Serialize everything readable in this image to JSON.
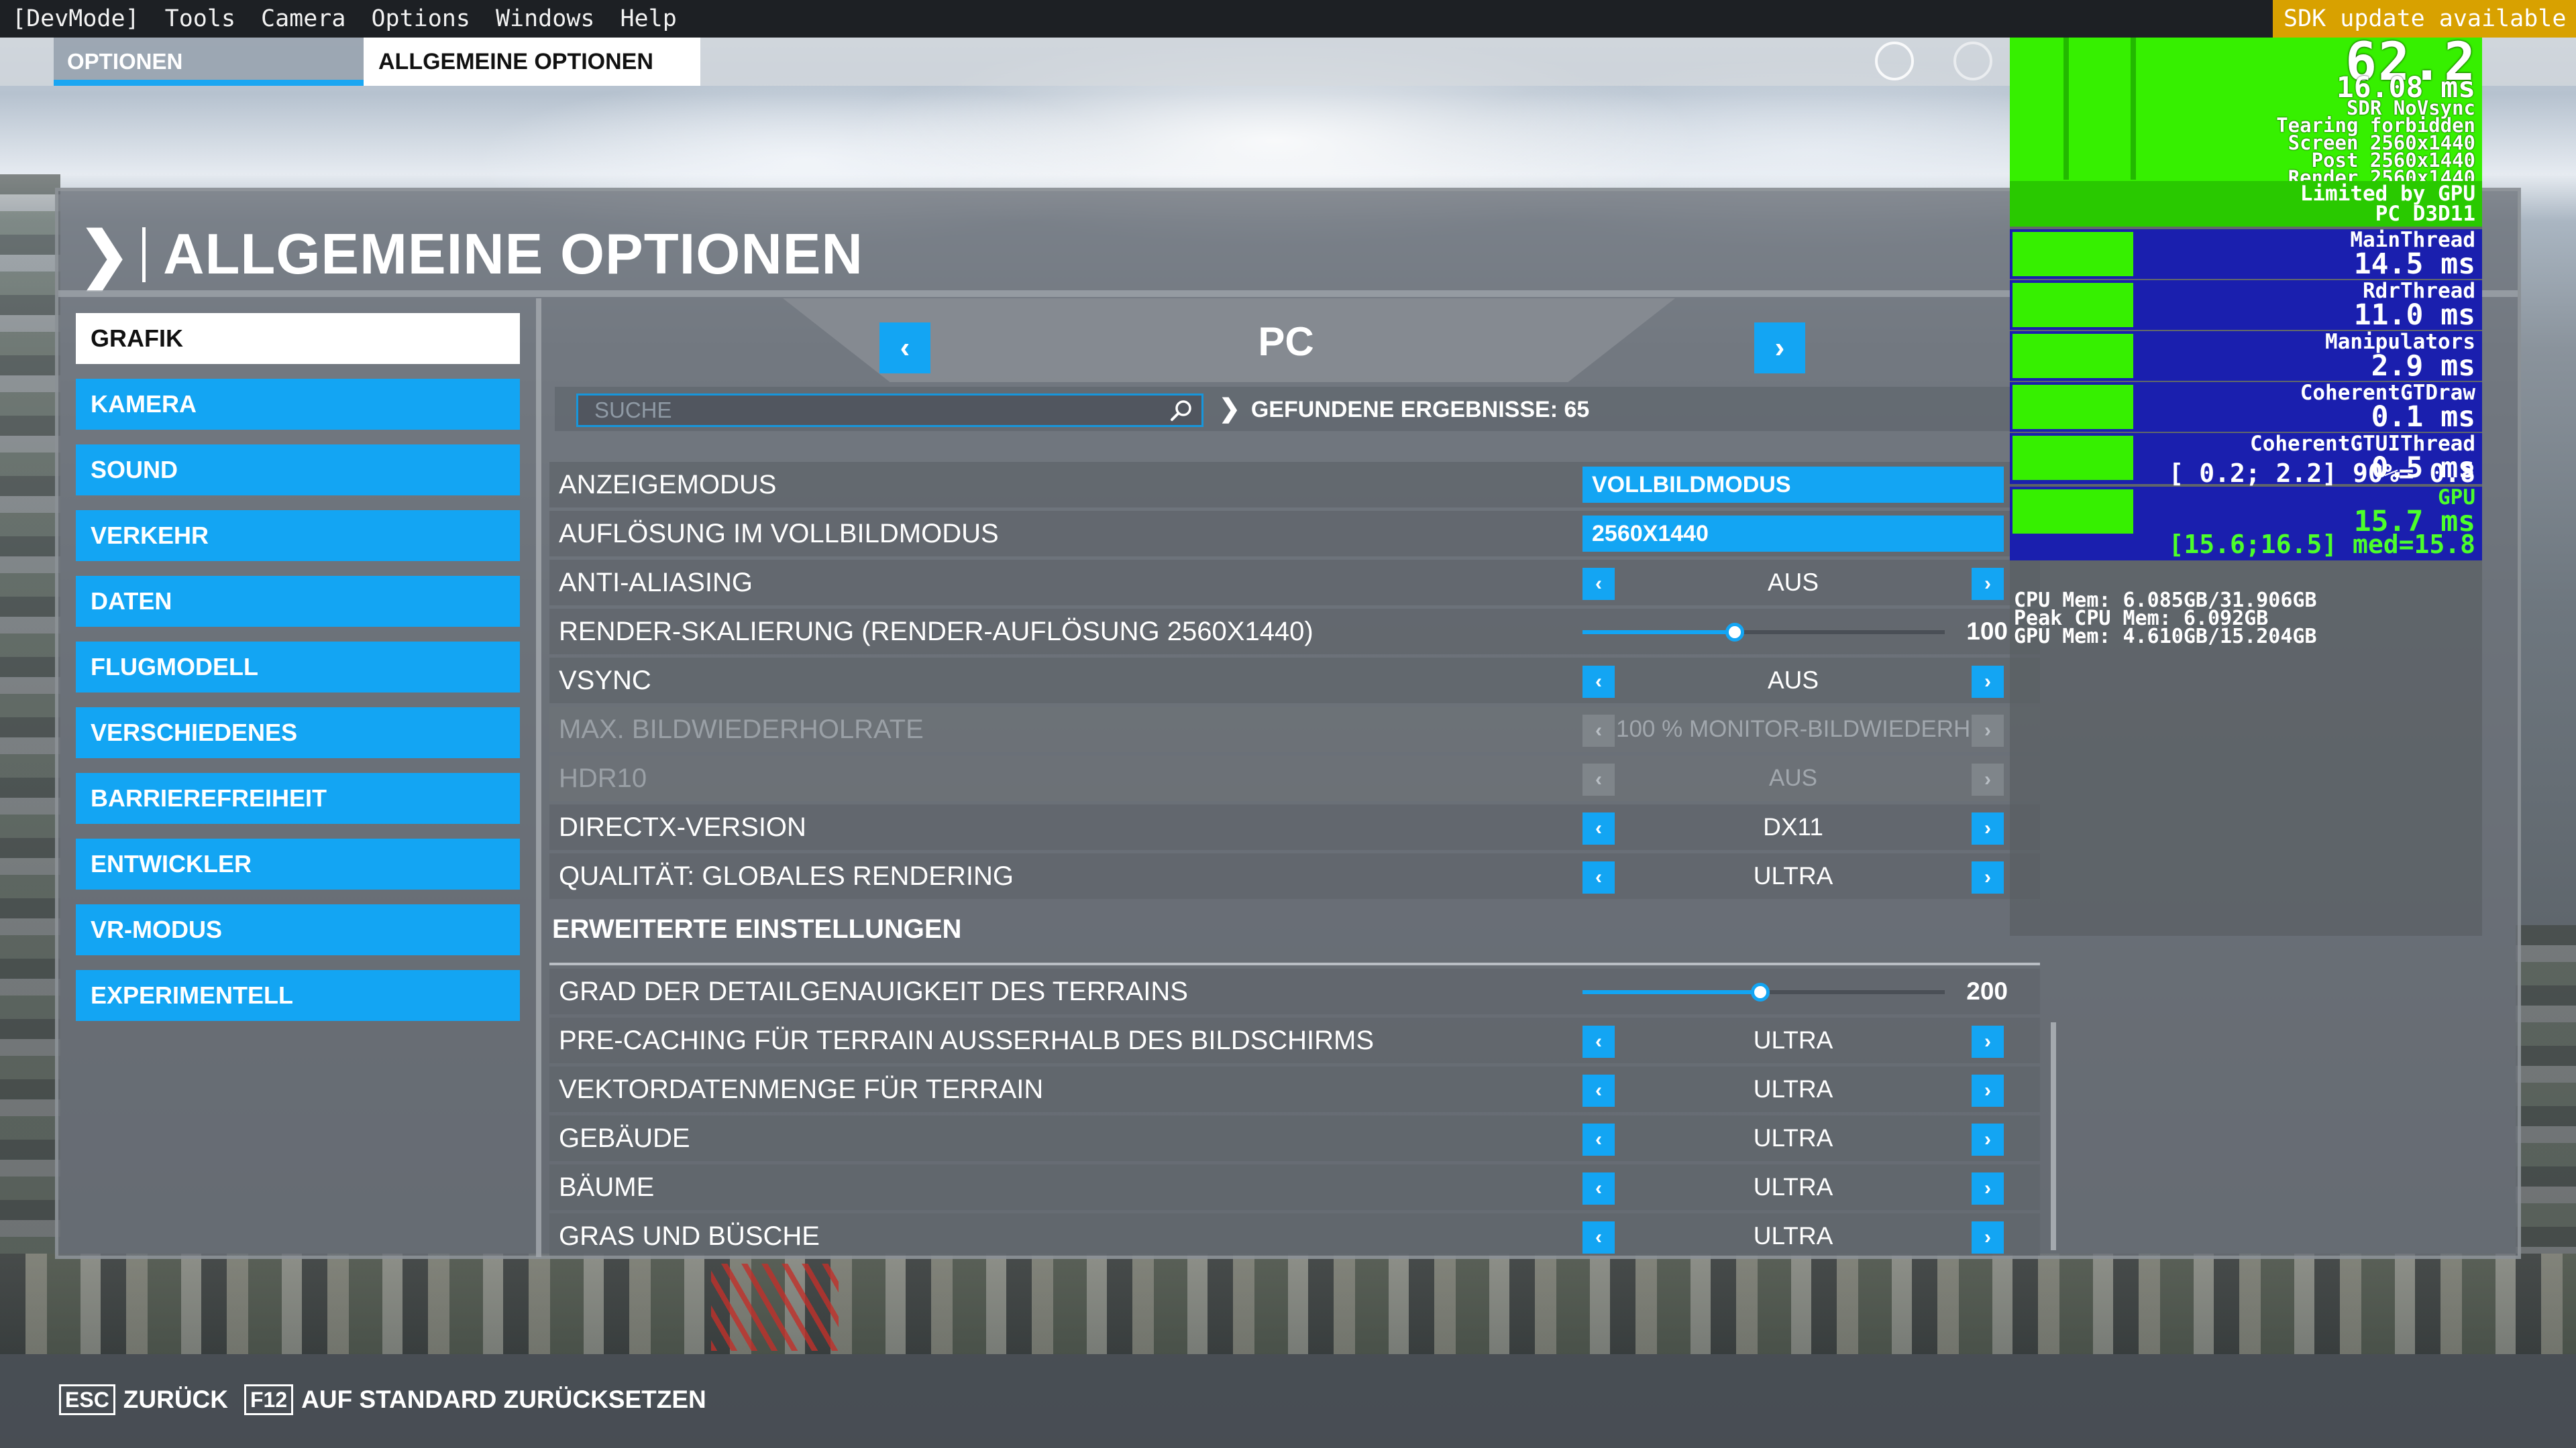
{
  "devbar": {
    "items": [
      "[DevMode]",
      "Tools",
      "Camera",
      "Options",
      "Windows",
      "Help"
    ],
    "sdk_notice": "SDK update available"
  },
  "tabs": {
    "options": "OPTIONEN",
    "general": "ALLGEMEINE OPTIONEN"
  },
  "page": {
    "title": "ALLGEMEINE OPTIONEN"
  },
  "sidebar": {
    "items": [
      {
        "label": "GRAFIK",
        "active": true
      },
      {
        "label": "KAMERA"
      },
      {
        "label": "SOUND"
      },
      {
        "label": "VERKEHR"
      },
      {
        "label": "DATEN"
      },
      {
        "label": "FLUGMODELL"
      },
      {
        "label": "VERSCHIEDENES"
      },
      {
        "label": "BARRIEREFREIHEIT"
      },
      {
        "label": "ENTWICKLER"
      },
      {
        "label": "VR-MODUS"
      },
      {
        "label": "EXPERIMENTELL"
      }
    ]
  },
  "profile": {
    "name": "PC"
  },
  "search": {
    "placeholder": "SUCHE",
    "results_label": "GEFUNDENE ERGEBNISSE: 65"
  },
  "settings": [
    {
      "label": "ANZEIGEMODUS",
      "type": "value",
      "value": "VOLLBILDMODUS"
    },
    {
      "label": "AUFLÖSUNG IM VOLLBILDMODUS",
      "type": "value",
      "value": "2560X1440"
    },
    {
      "label": "ANTI-ALIASING",
      "type": "select",
      "value": "AUS"
    },
    {
      "label": "RENDER-SKALIERUNG (RENDER-AUFLÖSUNG 2560X1440)",
      "type": "slider",
      "value": "100",
      "fraction": 0.42
    },
    {
      "label": "VSYNC",
      "type": "select",
      "value": "AUS"
    },
    {
      "label": "MAX. BILDWIEDERHOLRATE",
      "type": "select",
      "value": "100 % MONITOR-BILDWIEDERH",
      "disabled": true
    },
    {
      "label": "HDR10",
      "type": "select",
      "value": "AUS",
      "disabled": true
    },
    {
      "label": "DIRECTX-VERSION",
      "type": "select",
      "value": "DX11"
    },
    {
      "label": "QUALITÄT: GLOBALES RENDERING",
      "type": "select",
      "value": "ULTRA"
    },
    {
      "label": "ERWEITERTE EINSTELLUNGEN",
      "type": "section"
    },
    {
      "label": "GRAD DER DETAILGENAUIGKEIT DES TERRAINS",
      "type": "slider",
      "value": "200",
      "fraction": 0.49
    },
    {
      "label": "PRE-CACHING FÜR TERRAIN AUSSERHALB DES BILDSCHIRMS",
      "type": "select",
      "value": "ULTRA"
    },
    {
      "label": "VEKTORDATENMENGE FÜR TERRAIN",
      "type": "select",
      "value": "ULTRA"
    },
    {
      "label": "GEBÄUDE",
      "type": "select",
      "value": "ULTRA"
    },
    {
      "label": "BÄUME",
      "type": "select",
      "value": "ULTRA"
    },
    {
      "label": "GRAS UND BÜSCHE",
      "type": "select",
      "value": "ULTRA"
    }
  ],
  "footer": {
    "back_key": "ESC",
    "back_label": "ZURÜCK",
    "reset_key": "F12",
    "reset_label": "AUF STANDARD ZURÜCKSETZEN"
  },
  "perf": {
    "fps": "62.2",
    "frame_time": "16.08 ms",
    "info_lines": [
      "SDR NoVsync",
      "Tearing forbidden",
      "Screen 2560x1440",
      "Post 2560x1440",
      "Render 2560x1440"
    ],
    "limited": [
      "Limited by GPU",
      "PC D3D11"
    ],
    "threads": [
      {
        "name": "MainThread",
        "value": "14.5 ms"
      },
      {
        "name": "RdrThread",
        "value": "11.0 ms"
      },
      {
        "name": "Manipulators",
        "value": "2.9 ms"
      },
      {
        "name": "CoherentGTDraw",
        "value": "0.1 ms"
      },
      {
        "name": "CoherentGTUIThread",
        "value": "0.5 ms",
        "stat": "[ 0.2; 2.2] 90%= 0.8"
      },
      {
        "name": "GPU",
        "value": "15.7 ms",
        "stat": "[15.6;16.5] med=15.8",
        "gpu": true
      }
    ],
    "mem_lines": [
      "CPU Mem: 6.085GB/31.906GB",
      "Peak CPU Mem: 6.092GB",
      "GPU Mem: 4.610GB/15.204GB"
    ]
  },
  "colors": {
    "accent": "#13a5f3",
    "perf_green": "#36f000",
    "perf_blue": "#1a1fae",
    "sdk_banner": "#d8a100"
  }
}
